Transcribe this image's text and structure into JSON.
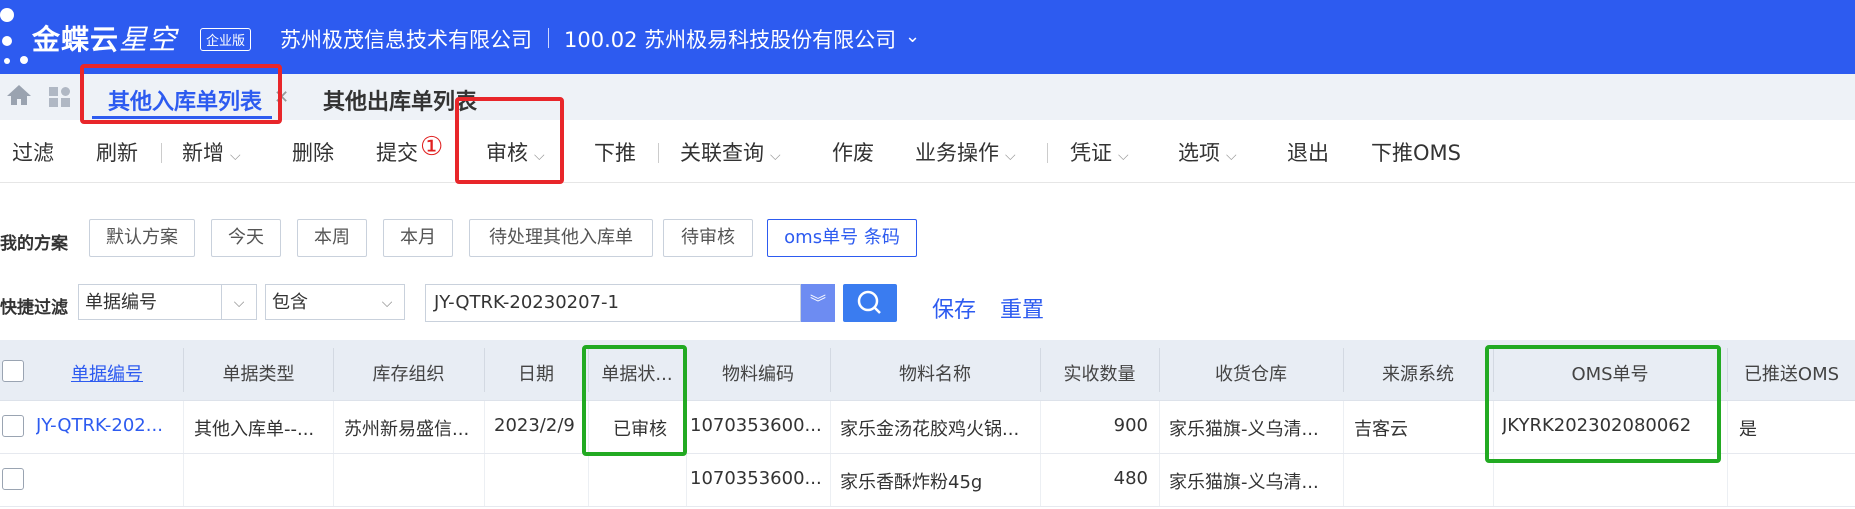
{
  "header": {
    "brand": "金蝶云",
    "brand_sub": "星空",
    "edition_badge": "企业版",
    "org": "苏州极茂信息技术有限公司",
    "company": "100.02 苏州极易科技股份有限公司"
  },
  "tabs": [
    {
      "label": "其他入库单列表",
      "active": true
    },
    {
      "label": "其他出库单列表",
      "active": false
    }
  ],
  "toolbar": {
    "filter": "过滤",
    "refresh": "刷新",
    "new": "新增",
    "delete": "删除",
    "submit": "提交",
    "annotation_marker": "①",
    "audit": "审核",
    "push_down": "下推",
    "related_query": "关联查询",
    "void": "作废",
    "business_ops": "业务操作",
    "voucher": "凭证",
    "options": "选项",
    "exit": "退出",
    "push_oms": "下推OMS"
  },
  "schemes": {
    "label": "我的方案",
    "chips": [
      "默认方案",
      "今天",
      "本周",
      "本月",
      "待处理其他入库单",
      "待审核",
      "oms单号 条码"
    ]
  },
  "quick_filter": {
    "label": "快捷过滤",
    "field": "单据编号",
    "operator": "包含",
    "value": "JY-QTRK-20230207-1",
    "save": "保存",
    "reset": "重置"
  },
  "table": {
    "headers": [
      "单据编号",
      "单据类型",
      "库存组织",
      "日期",
      "单据状...",
      "物料编码",
      "物料名称",
      "实收数量",
      "收货仓库",
      "来源系统",
      "OMS单号",
      "已推送OMS"
    ],
    "rows": [
      [
        "JY-QTRK-202...",
        "其他入库单--...",
        "苏州新易盛信...",
        "2023/2/9",
        "已审核",
        "1070353600...",
        "家乐金汤花胶鸡火锅...",
        "900",
        "家乐猫旗-义乌清...",
        "吉客云",
        "JKYRK202302080062",
        "是"
      ],
      [
        "",
        "",
        "",
        "",
        "",
        "1070353600...",
        "家乐香酥炸粉45g",
        "480",
        "家乐猫旗-义乌清...",
        "",
        "",
        ""
      ]
    ]
  },
  "colors": {
    "header_bg": "#2d5bf0",
    "accent": "#2d5bf0",
    "annotation_red": "#e8262a",
    "annotation_green": "#22aa22"
  }
}
